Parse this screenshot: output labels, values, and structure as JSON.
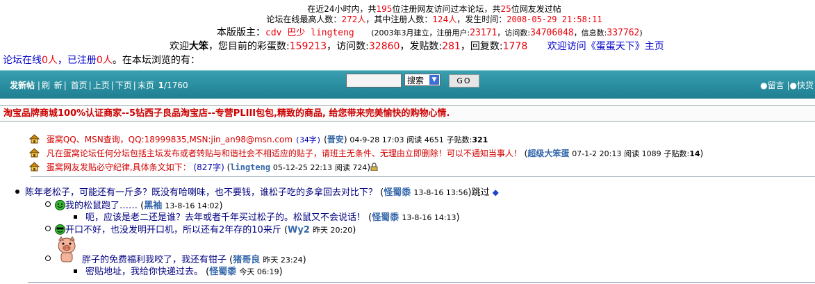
{
  "header": {
    "stats1_a": "在近24小时内，共",
    "stats1_n1": "195",
    "stats1_b": "位注册网友访问过本论坛，共",
    "stats1_n2": "25",
    "stats1_c": "位网友发过帖",
    "stats2_a": "论坛在线最高人数：",
    "stats2_n1": "272人",
    "stats2_b": "，其中注册人数：",
    "stats2_n2": "124人",
    "stats2_c": "，发生时间：",
    "stats2_time": "2008-05-29 21:58:11"
  },
  "moderators": {
    "label": "本版版主：",
    "names": "cdv 巴少 lingteng",
    "info_a": "(2003年3月建立，注册用户:",
    "users": "23171",
    "info_b": "，访问数:",
    "visits": "34706048",
    "info_c": "，信息数:",
    "messages": "337762",
    "info_d": ")"
  },
  "welcome": {
    "a": "欢迎",
    "user": "大笨",
    "b": "，您目前的彩蛋数:",
    "eggs": "159213",
    "c": "，访问数:",
    "visits": "32860",
    "d": "，发贴数:",
    "posts": "281",
    "e": "，回复数:",
    "replies": "1778",
    "link": "欢迎访问《蛋蛋天下》主页"
  },
  "online": {
    "a": "论坛在线",
    "n1": "0人",
    "b": "，已注册",
    "n2": "0人",
    "c": "。在本坛浏览的有："
  },
  "toolbar": {
    "new_post": "发新帖",
    "refresh": "刷",
    "new": "新",
    "first": "首页",
    "prev": "上页",
    "next": "下页",
    "last": "末页",
    "page": "1",
    "total": "/1760",
    "search_value": "",
    "select_value": "搜索",
    "go": "GO",
    "msg": "留言",
    "quick": "快货"
  },
  "ad": {
    "text": "淘宝品牌商城100%认证商家--5钻西子良品淘宝店--专营PLIII包包,精致的商品, 给您带来完美愉快的购物心情."
  },
  "pinned": [
    {
      "title": "蛋窝QQ、MSN查询，QQ:18999835,MSN:jin_an98@msn.com",
      "size": "(34字)",
      "author": "晋安",
      "date": "04-9-28 17:03",
      "views": "阅读 4651",
      "replies_label": "子贴数:",
      "replies": "321"
    },
    {
      "title": "凡在蛋窝论坛任何分坛包括主坛发布或者转贴与和谐社会不相适应的贴子，请班主无条件、无理由立即删除！可以不通知当事人！",
      "size": "",
      "author": "超级大笨蛋",
      "date": "07-1-2 20:13",
      "views": "阅读 1089",
      "replies_label": "子贴数:",
      "replies": "14"
    },
    {
      "title": "蛋窝网友发贴必守纪律,具体条文如下：",
      "size": "(827字)",
      "author": "lingteng",
      "date": "05-12-25 22:13",
      "views": "阅读 724",
      "replies_label": "",
      "replies": ""
    }
  ],
  "threads": [
    {
      "title": "陈年老松子，可能还有一斤多？既没有哈喇味，也不要钱，谁松子吃的多拿回去对比下？",
      "author": "怪蜀黍",
      "date": "13-8-16 13:56",
      "suffix": "跳过"
    },
    {
      "title": "我的松鼠跑了……",
      "author": "黑袖",
      "date": "13-8-16 14:02"
    },
    {
      "title": "呃，应该是老二还是谁？去年或者千年买过松子的。松鼠又不会说话！",
      "author": "怪蜀黍",
      "date": "13-8-16 14:13"
    },
    {
      "title": "开口不好，也没发明开口机，所以还有2年存的10来斤",
      "author": "Wy2",
      "date": "昨天 20:20"
    },
    {
      "title": "胖子的免费福利我咬了，我还有钳子",
      "author": "猪哥良",
      "date": "昨天 23:24"
    },
    {
      "title": "密贴地址，我给你快递过去。",
      "author": "怪蜀黍",
      "date": "今天 06:19"
    }
  ],
  "colors": {
    "accent": "#2a8fa1",
    "red": "#e8000b",
    "link": "#0000cc"
  }
}
